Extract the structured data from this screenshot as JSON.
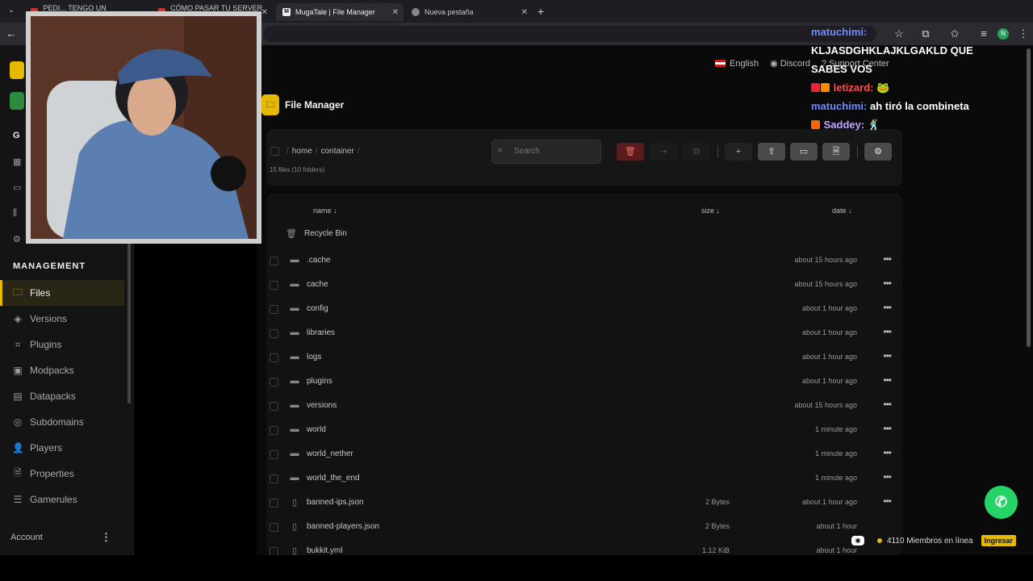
{
  "browser": {
    "tabs": [
      {
        "label": "PEDI... TENGO UN SERVI...",
        "active": false
      },
      {
        "label": "CÓMO PASAR TU SERVER D...",
        "active": false
      },
      {
        "label": "MugaTale | File Manager",
        "active": true
      },
      {
        "label": "Nueva pestaña",
        "active": false
      }
    ],
    "new_tab": "+",
    "profile_initial": "N"
  },
  "sidebar": {
    "section_title": "MANAGEMENT",
    "partial_title": "G",
    "items": [
      {
        "label": "Files",
        "icon": "folder-icon",
        "active": true
      },
      {
        "label": "Versions",
        "icon": "layers-icon"
      },
      {
        "label": "Plugins",
        "icon": "plugin-icon"
      },
      {
        "label": "Modpacks",
        "icon": "box-icon"
      },
      {
        "label": "Datapacks",
        "icon": "archive-icon"
      },
      {
        "label": "Subdomains",
        "icon": "globe-icon"
      },
      {
        "label": "Players",
        "icon": "user-icon"
      },
      {
        "label": "Properties",
        "icon": "file-icon"
      },
      {
        "label": "Gamerules",
        "icon": "list-icon"
      }
    ],
    "account_label": "Account",
    "account_menu": "⋮"
  },
  "topbar": {
    "language": "English",
    "discord": "Discord",
    "support": "Support Center"
  },
  "file_manager": {
    "title": "File Manager",
    "breadcrumb": [
      "home",
      "container"
    ],
    "file_count": "15 files (10 folders)",
    "search_placeholder": "Search",
    "columns": {
      "name": "name ↓",
      "size": "size ↓",
      "date": "date ↓"
    },
    "recycle_bin": "Recycle Bin",
    "rows": [
      {
        "name": ".cache",
        "type": "folder",
        "size": "",
        "date": "about 15 hours ago"
      },
      {
        "name": "cache",
        "type": "folder",
        "size": "",
        "date": "about 15 hours ago"
      },
      {
        "name": "config",
        "type": "folder",
        "size": "",
        "date": "about 1 hour ago"
      },
      {
        "name": "libraries",
        "type": "folder",
        "size": "",
        "date": "about 1 hour ago"
      },
      {
        "name": "logs",
        "type": "folder",
        "size": "",
        "date": "about 1 hour ago"
      },
      {
        "name": "plugins",
        "type": "folder",
        "size": "",
        "date": "about 1 hour ago"
      },
      {
        "name": "versions",
        "type": "folder",
        "size": "",
        "date": "about 15 hours ago"
      },
      {
        "name": "world",
        "type": "folder",
        "size": "",
        "date": "1 minute ago"
      },
      {
        "name": "world_nether",
        "type": "folder",
        "size": "",
        "date": "1 minute ago"
      },
      {
        "name": "world_the_end",
        "type": "folder",
        "size": "",
        "date": "1 minute ago"
      },
      {
        "name": "banned-ips.json",
        "type": "file",
        "size": "2 Bytes",
        "date": "about 1 hour ago"
      },
      {
        "name": "banned-players.json",
        "type": "file",
        "size": "2 Bytes",
        "date": "about 1 hour"
      },
      {
        "name": "bukkit.yml",
        "type": "file",
        "size": "1.12 KiB",
        "date": "about 1 hour"
      }
    ]
  },
  "chat": {
    "lines": [
      {
        "user": "matuchimi:",
        "text": "",
        "color": "#6c8cff"
      },
      {
        "user": "",
        "text": "KLJASDGHKLAJKLGAKLD QUE",
        "color": "#ffffff"
      },
      {
        "user": "",
        "text": "SABES VOS",
        "color": "#ffffff"
      },
      {
        "user": "letizard:",
        "text": "🐸",
        "color": "#ff4d4d"
      },
      {
        "user": "matuchimi:",
        "text": "ah tiró la combineta",
        "color": "#6c8cff"
      },
      {
        "user": "Saddey:",
        "text": "🕺",
        "color": "#c7a5ff"
      }
    ]
  },
  "discord_widget": {
    "members": "4110 Miembros en línea",
    "join": "Ingresar"
  },
  "colors": {
    "accent": "#e6b800",
    "danger": "#5a1c1c",
    "whatsapp": "#25d366"
  }
}
